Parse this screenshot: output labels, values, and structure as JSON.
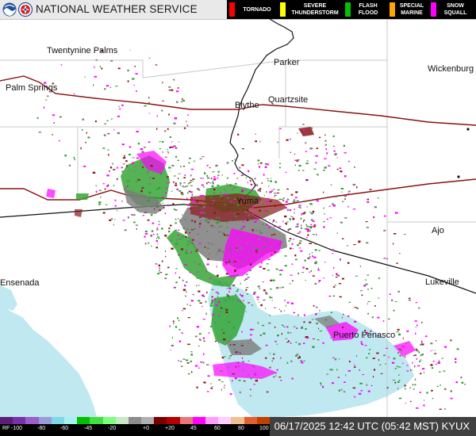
{
  "header": {
    "title": "NATIONAL WEATHER SERVICE",
    "logos": [
      "noaa-logo",
      "nws-logo"
    ]
  },
  "legend": [
    {
      "label": "TORNADO",
      "color": "#ff0000"
    },
    {
      "label": "SEVERE THUNDERSTORM",
      "color": "#ffff00"
    },
    {
      "label": "FLASH FLOOD",
      "color": "#00c000"
    },
    {
      "label": "SPECIAL MARINE",
      "color": "#ffa500"
    },
    {
      "label": "SNOW SQUALL",
      "color": "#ff00ff"
    }
  ],
  "cities": [
    {
      "name": "Twentynine Palms"
    },
    {
      "name": "Parker"
    },
    {
      "name": "Wickenburg"
    },
    {
      "name": "Palm Springs"
    },
    {
      "name": "Blythe"
    },
    {
      "name": "Quartzsite"
    },
    {
      "name": "Yuma"
    },
    {
      "name": "Ajo"
    },
    {
      "name": "Ensenada"
    },
    {
      "name": "Lukeville"
    },
    {
      "name": "Puerto Penasco"
    }
  ],
  "scale": {
    "prefix": "RF",
    "ticks": [
      "-100",
      "-80",
      "-60",
      "-45",
      "-20",
      "+0",
      "+20",
      "45",
      "60",
      "80",
      "100"
    ],
    "colors": [
      "#5b1f7a",
      "#7b2fa8",
      "#9a5fc8",
      "#9b9bd8",
      "#7fd8e8",
      "#a8f0f0",
      "#00c000",
      "#3fe03f",
      "#7fff7f",
      "#c8e8c8",
      "#8c8c8c",
      "#b0b0b0",
      "#7a0000",
      "#b40000",
      "#e87878",
      "#ff00ff",
      "#ff9cff",
      "#ffd0ff",
      "#f0c090",
      "#e06030",
      "#c04000"
    ]
  },
  "timestamp": "06/17/2025 12:42 UTC (05:42 MST) KYUX",
  "colors": {
    "water": "#bfe8f0",
    "border": "#111111",
    "highway": "#8b1010",
    "county": "#c0c0c0",
    "radar_magenta": "#ff00ff",
    "radar_green": "#2aa02a",
    "radar_gray": "#7c7c7c",
    "radar_maroon": "#8a1818"
  }
}
